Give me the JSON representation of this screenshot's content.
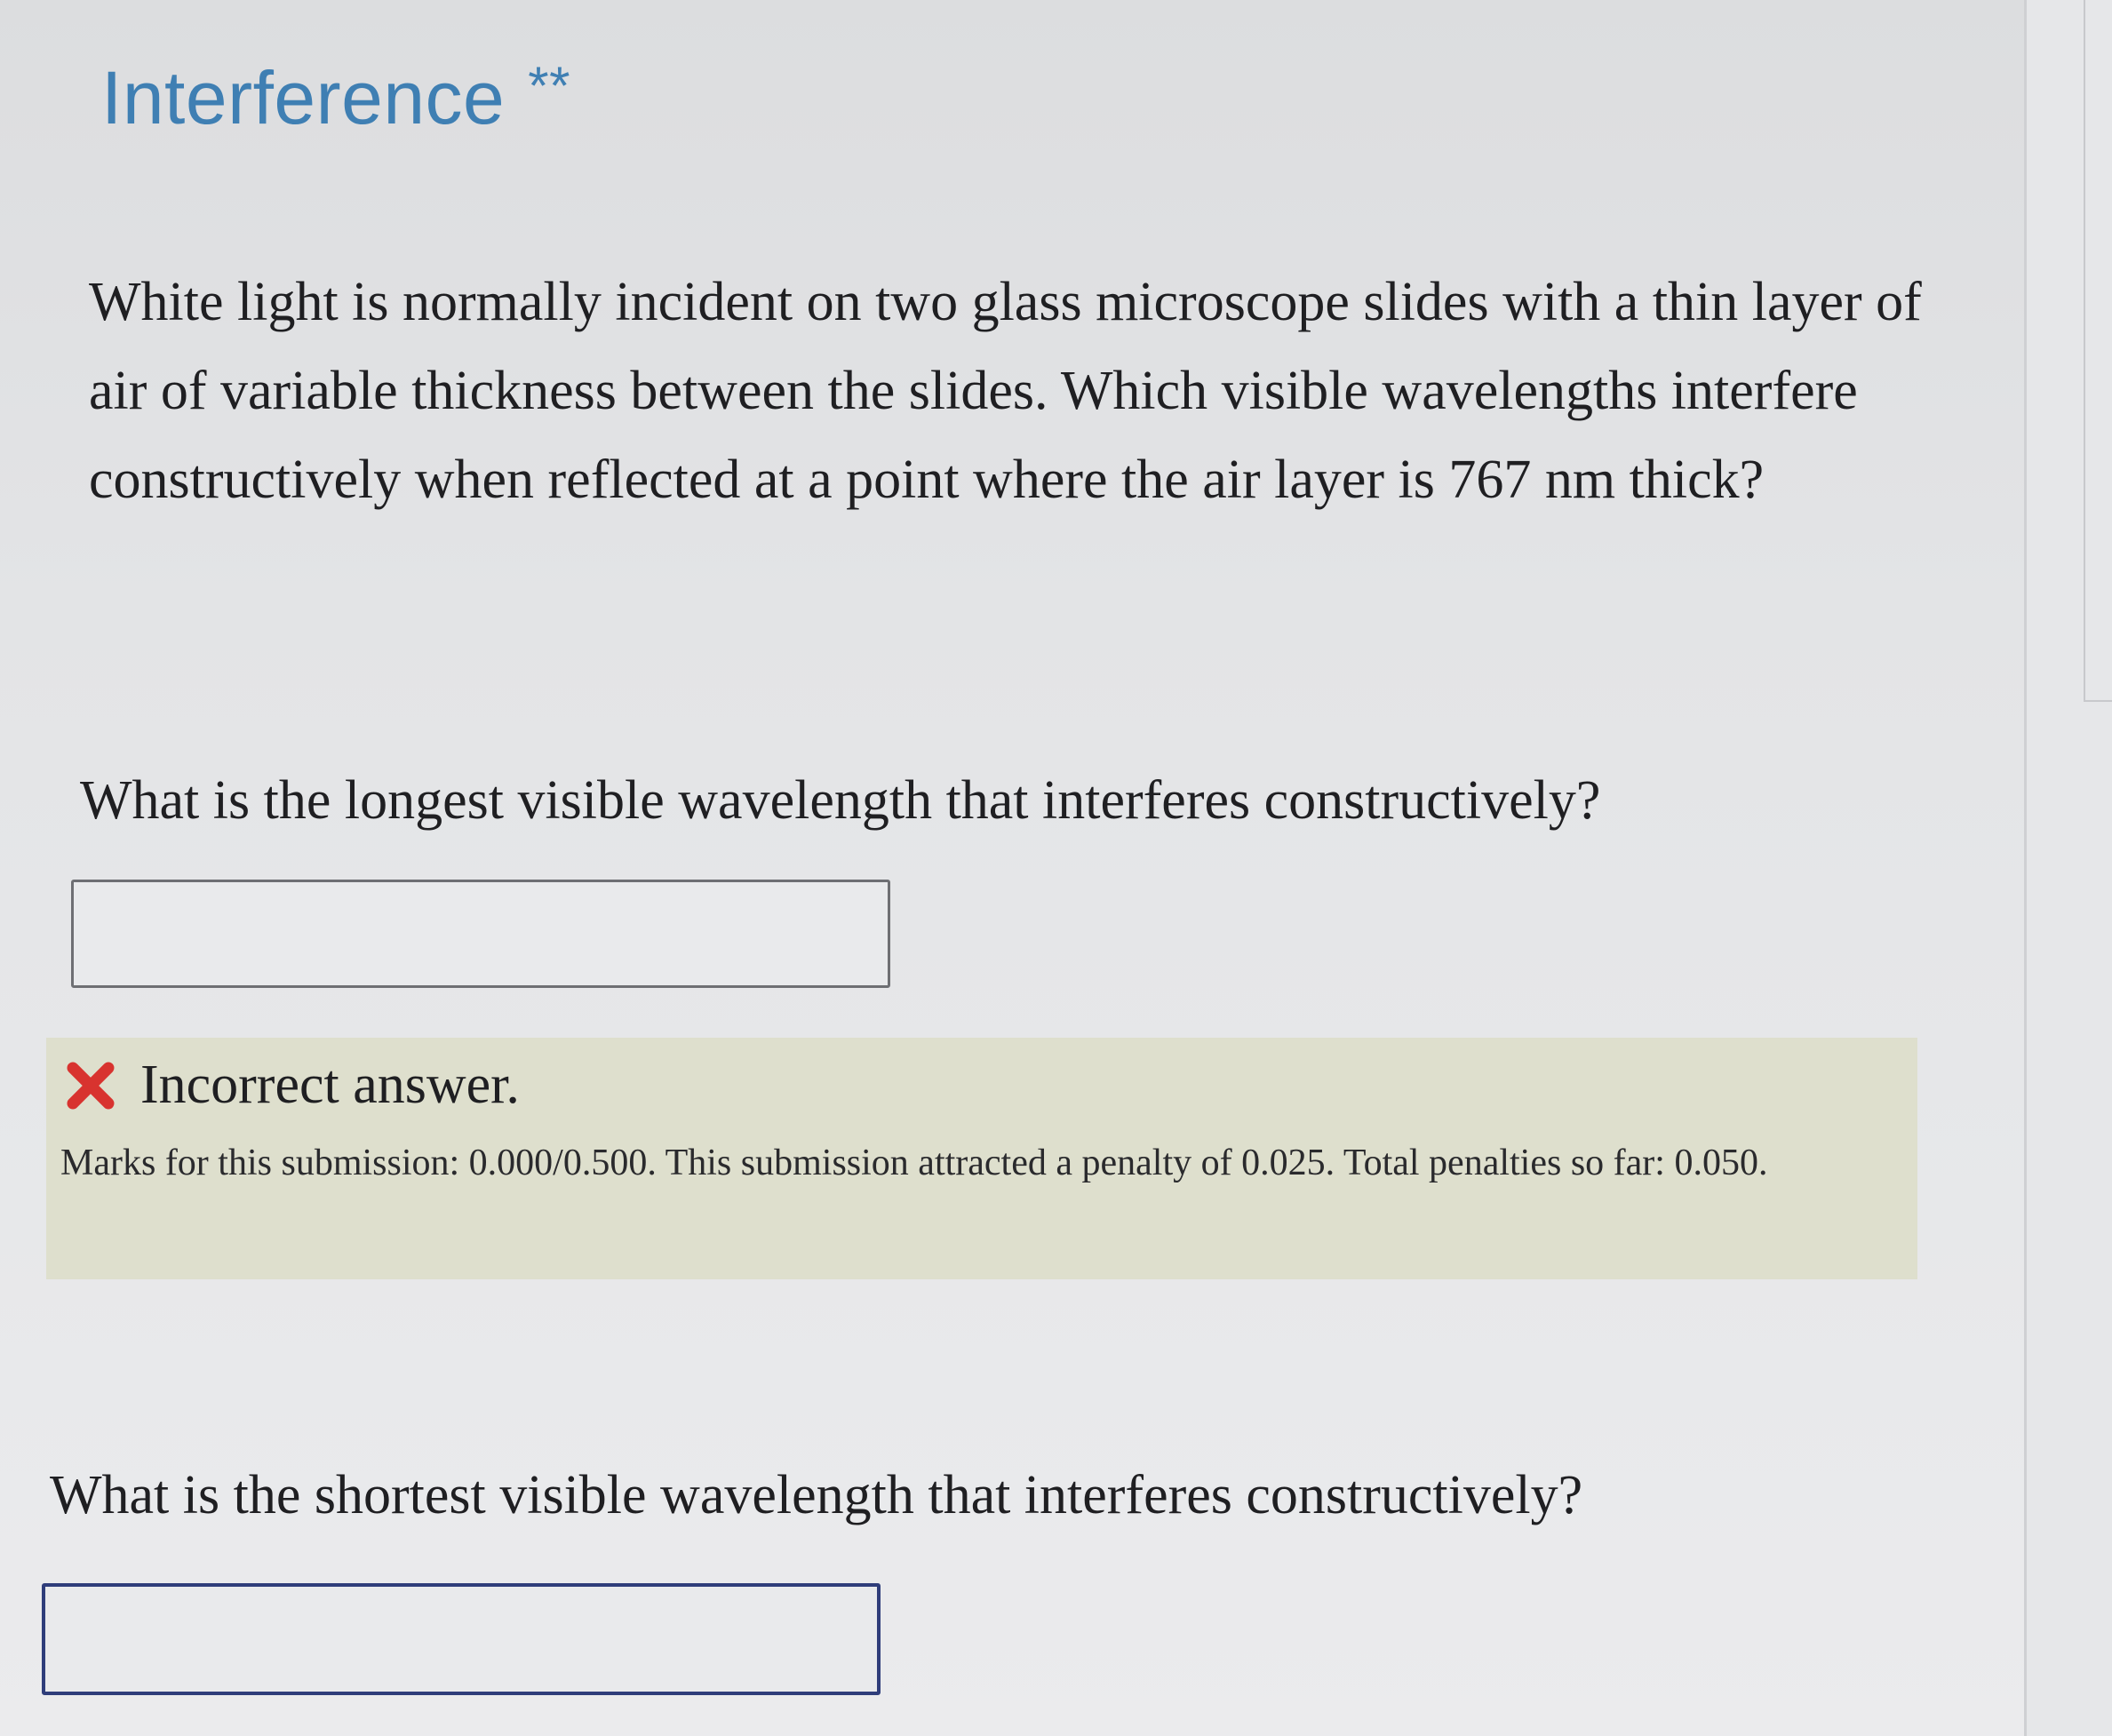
{
  "page": {
    "title": "Interference",
    "title_stars": "**"
  },
  "question": {
    "text": "White light is normally incident on two glass microscope slides with a thin layer of air of variable thickness between the slides. Which visible wavelengths interfere constructively when reflected at a point where the air layer is 767 nm thick?"
  },
  "part1": {
    "prompt": "What is the longest visible wavelength that interferes constructively?",
    "input_value": ""
  },
  "feedback": {
    "status_icon": "x-icon",
    "status_color": "#d8332f",
    "status_text": "Incorrect answer.",
    "marks_text": "Marks for this submission: 0.000/0.500. This submission attracted a penalty of 0.025. Total penalties so far: 0.050."
  },
  "part2": {
    "prompt": "What is the shortest visible wavelength that interferes constructively?",
    "input_value": ""
  },
  "colors": {
    "title": "#3f7fb3",
    "feedback_background": "#dedfcd",
    "active_input_border": "#2f3d7a"
  }
}
